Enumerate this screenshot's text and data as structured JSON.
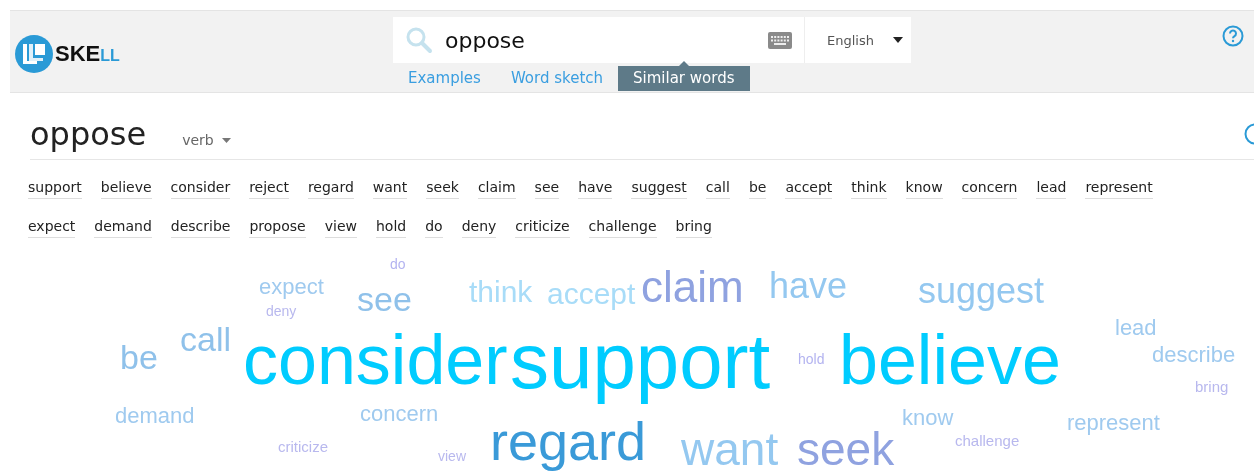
{
  "logo": {
    "text": "SKE",
    "suffix": "LL"
  },
  "search": {
    "value": "oppose",
    "language": "English"
  },
  "tabs": [
    {
      "label": "Examples",
      "selected": false
    },
    {
      "label": "Word sketch",
      "selected": false
    },
    {
      "label": "Similar words",
      "selected": true
    }
  ],
  "heading": {
    "word": "oppose",
    "part_of_speech": "verb"
  },
  "similar_words": [
    "support",
    "believe",
    "consider",
    "reject",
    "regard",
    "want",
    "seek",
    "claim",
    "see",
    "have",
    "suggest",
    "call",
    "be",
    "accept",
    "think",
    "know",
    "concern",
    "lead",
    "represent",
    "expect",
    "demand",
    "describe",
    "propose",
    "view",
    "hold",
    "do",
    "deny",
    "criticize",
    "challenge",
    "bring"
  ],
  "word_cloud": [
    {
      "word": "do",
      "color": "#b3b3f0"
    },
    {
      "word": "expect",
      "color": "#9fcaef"
    },
    {
      "word": "deny",
      "color": "#b8b8ee"
    },
    {
      "word": "see",
      "color": "#8fc1ea"
    },
    {
      "word": "think",
      "color": "#a8dcf8"
    },
    {
      "word": "accept",
      "color": "#a8dcf8"
    },
    {
      "word": "claim",
      "color": "#8fa2e0"
    },
    {
      "word": "have",
      "color": "#94c8f0"
    },
    {
      "word": "suggest",
      "color": "#94c8f0"
    },
    {
      "word": "lead",
      "color": "#9fcaef"
    },
    {
      "word": "call",
      "color": "#8fc1ea"
    },
    {
      "word": "be",
      "color": "#8fc1ea"
    },
    {
      "word": "consider",
      "color": "#00ccff"
    },
    {
      "word": "support",
      "color": "#00ccff"
    },
    {
      "word": "hold",
      "color": "#b3b3f0"
    },
    {
      "word": "believe",
      "color": "#00ccff"
    },
    {
      "word": "describe",
      "color": "#9fcaef"
    },
    {
      "word": "bring",
      "color": "#b8b8ee"
    },
    {
      "word": "demand",
      "color": "#9fcaef"
    },
    {
      "word": "concern",
      "color": "#9fcaef"
    },
    {
      "word": "know",
      "color": "#9fcaef"
    },
    {
      "word": "represent",
      "color": "#9fcaef"
    },
    {
      "word": "criticize",
      "color": "#b8b8ee"
    },
    {
      "word": "challenge",
      "color": "#b8b8ee"
    },
    {
      "word": "view",
      "color": "#b8b8ee"
    },
    {
      "word": "regard",
      "color": "#3a9ad8"
    },
    {
      "word": "want",
      "color": "#94c8f0"
    },
    {
      "word": "seek",
      "color": "#8fa2e0"
    }
  ]
}
